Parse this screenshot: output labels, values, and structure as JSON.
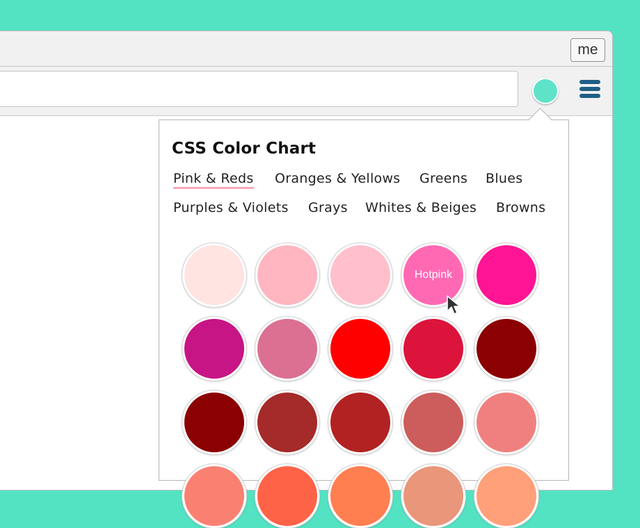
{
  "titlebar": {
    "me_label": "me"
  },
  "popup": {
    "title": "CSS Color Chart",
    "tabs": [
      {
        "label": "Pink & Reds",
        "active": true
      },
      {
        "label": "Oranges & Yellows"
      },
      {
        "label": "Greens"
      },
      {
        "label": "Blues"
      },
      {
        "label": "Purples & Violets"
      },
      {
        "label": "Grays"
      },
      {
        "label": "Whites & Beiges"
      },
      {
        "label": "Browns"
      }
    ],
    "hover_label": "Hotpink",
    "swatch_colors": [
      [
        "#ffe4e1",
        "#ffb6c1",
        "#ffc0cb",
        "#ff69b4",
        "#ff1493"
      ],
      [
        "#c71585",
        "#db7093",
        "#ff0000",
        "#dc143c",
        "#8b0000"
      ],
      [
        "#8b0000",
        "#a52a2a",
        "#b22222",
        "#cd5c5c",
        "#f08080"
      ],
      [
        "#fa8072",
        "#ff6347",
        "#ff7f50",
        "#e9967a",
        "#ffa07a"
      ]
    ]
  },
  "colors": {
    "background": "#53e3c3",
    "extension_icon": "#5ee3c9",
    "menu_icon": "#1e5f86",
    "active_tab_underline": "#f7a8bd"
  }
}
